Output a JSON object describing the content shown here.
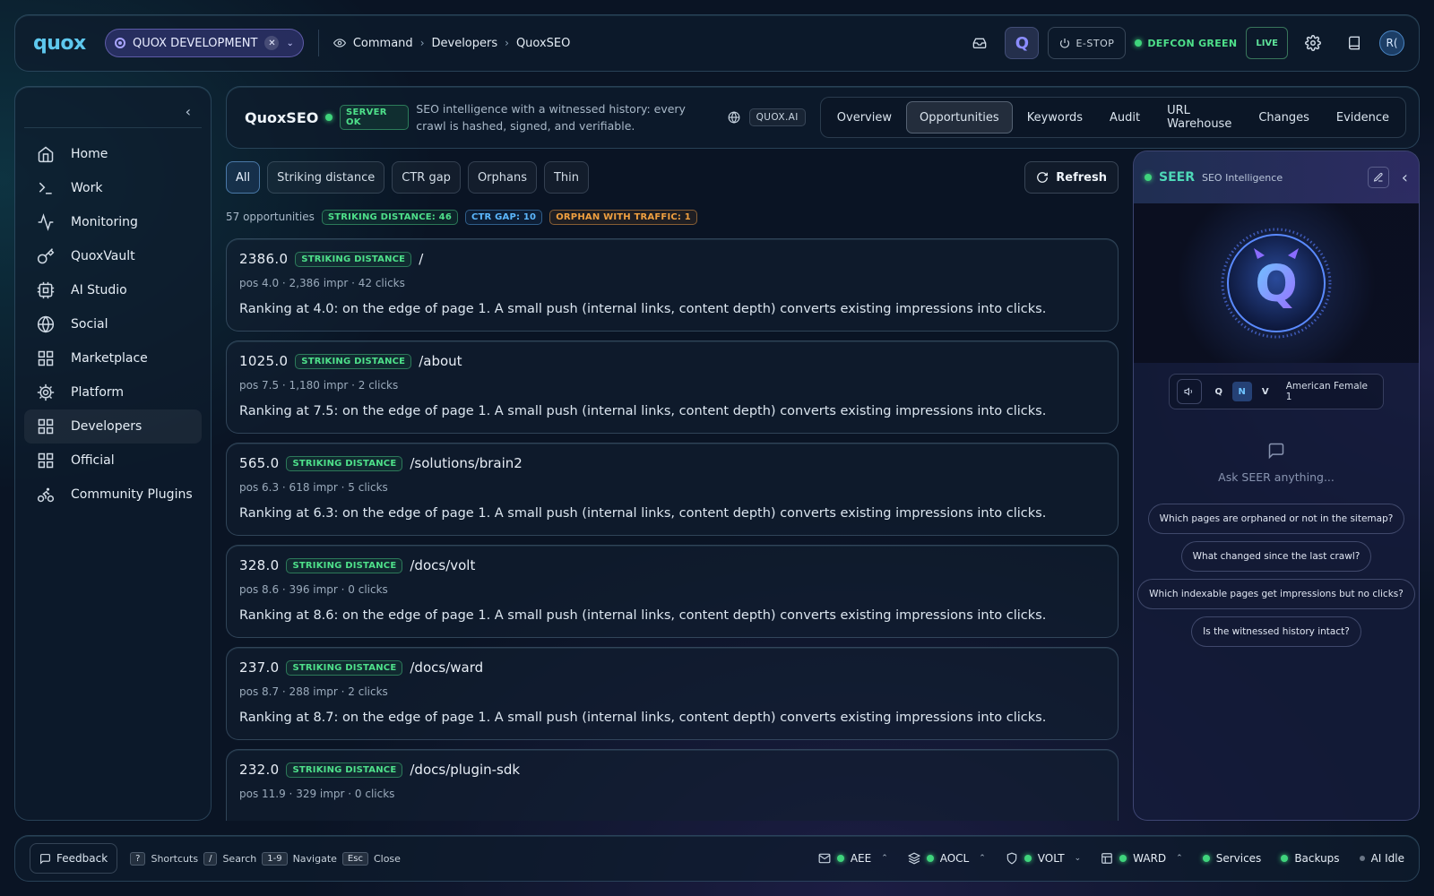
{
  "topbar": {
    "logo": "quox",
    "workspace": "QUOX DEVELOPMENT",
    "breadcrumbs": [
      "Command",
      "Developers",
      "QuoxSEO"
    ],
    "estop": "E-STOP",
    "defcon": "DEFCON GREEN",
    "live": "LIVE",
    "avatar_initials": "R("
  },
  "sidebar": {
    "items": [
      {
        "label": "Home",
        "icon": "home-icon"
      },
      {
        "label": "Work",
        "icon": "terminal-icon"
      },
      {
        "label": "Monitoring",
        "icon": "activity-icon"
      },
      {
        "label": "QuoxVault",
        "icon": "key-icon"
      },
      {
        "label": "AI Studio",
        "icon": "cpu-icon"
      },
      {
        "label": "Social",
        "icon": "globe-icon"
      },
      {
        "label": "Marketplace",
        "icon": "grid-icon"
      },
      {
        "label": "Platform",
        "icon": "gear-icon"
      },
      {
        "label": "Developers",
        "icon": "grid-icon"
      },
      {
        "label": "Official",
        "icon": "grid-icon"
      },
      {
        "label": "Community Plugins",
        "icon": "bike-icon"
      }
    ]
  },
  "app": {
    "name": "QuoxSEO",
    "status": "SERVER OK",
    "description": "SEO intelligence with a witnessed history: every crawl is hashed, signed, and verifiable.",
    "domain": "QUOX.AI",
    "tabs": [
      "Overview",
      "Opportunities",
      "Keywords",
      "Audit",
      "URL Warehouse",
      "Changes",
      "Evidence"
    ],
    "active_tab": "Opportunities"
  },
  "filters": {
    "chips": [
      "All",
      "Striking distance",
      "CTR gap",
      "Orphans",
      "Thin"
    ],
    "active": "All",
    "refresh_label": "Refresh"
  },
  "summary": {
    "count_text": "57 opportunities",
    "badges": [
      "STRIKING DISTANCE: 46",
      "CTR GAP: 10",
      "ORPHAN WITH TRAFFIC: 1"
    ]
  },
  "opportunities": [
    {
      "score": "2386.0",
      "badge": "STRIKING DISTANCE",
      "path": "/",
      "meta": "pos 4.0 · 2,386 impr · 42 clicks",
      "reason": "Ranking at 4.0: on the edge of page 1. A small push (internal links, content depth) converts existing impressions into clicks."
    },
    {
      "score": "1025.0",
      "badge": "STRIKING DISTANCE",
      "path": "/about",
      "meta": "pos 7.5 · 1,180 impr · 2 clicks",
      "reason": "Ranking at 7.5: on the edge of page 1. A small push (internal links, content depth) converts existing impressions into clicks."
    },
    {
      "score": "565.0",
      "badge": "STRIKING DISTANCE",
      "path": "/solutions/brain2",
      "meta": "pos 6.3 · 618 impr · 5 clicks",
      "reason": "Ranking at 6.3: on the edge of page 1. A small push (internal links, content depth) converts existing impressions into clicks."
    },
    {
      "score": "328.0",
      "badge": "STRIKING DISTANCE",
      "path": "/docs/volt",
      "meta": "pos 8.6 · 396 impr · 0 clicks",
      "reason": "Ranking at 8.6: on the edge of page 1. A small push (internal links, content depth) converts existing impressions into clicks."
    },
    {
      "score": "237.0",
      "badge": "STRIKING DISTANCE",
      "path": "/docs/ward",
      "meta": "pos 8.7 · 288 impr · 2 clicks",
      "reason": "Ranking at 8.7: on the edge of page 1. A small push (internal links, content depth) converts existing impressions into clicks."
    },
    {
      "score": "232.0",
      "badge": "STRIKING DISTANCE",
      "path": "/docs/plugin-sdk",
      "meta": "pos 11.9 · 329 impr · 0 clicks",
      "reason": ""
    }
  ],
  "seer": {
    "title": "SEER",
    "subtitle": "SEO Intelligence",
    "avatar_letter": "Q",
    "voice_modes": [
      "Q",
      "N",
      "V"
    ],
    "voice_active": "N",
    "voice_name": "American Female 1",
    "ask_placeholder": "Ask SEER anything...",
    "suggestions": [
      "Which pages are orphaned or not in the sitemap?",
      "What changed since the last crawl?",
      "Which indexable pages get impressions but no clicks?",
      "Is the witnessed history intact?"
    ]
  },
  "footer": {
    "feedback": "Feedback",
    "shortcuts": [
      {
        "key": "?",
        "label": "Shortcuts"
      },
      {
        "key": "/",
        "label": "Search"
      },
      {
        "key": "1-9",
        "label": "Navigate"
      },
      {
        "key": "Esc",
        "label": "Close"
      }
    ],
    "services": [
      {
        "label": "AEE",
        "icon": "mail-icon",
        "chevron": "up"
      },
      {
        "label": "AOCL",
        "icon": "layers-icon",
        "chevron": "up"
      },
      {
        "label": "VOLT",
        "icon": "shield-icon",
        "chevron": "down"
      },
      {
        "label": "WARD",
        "icon": "window-icon",
        "chevron": "up"
      },
      {
        "label": "Services"
      },
      {
        "label": "Backups"
      },
      {
        "label": "AI Idle"
      }
    ]
  },
  "colors": {
    "accent_green": "#3fd47c",
    "accent_blue": "#5cb8ff",
    "accent_orange": "#f0a040",
    "seer_teal": "#4ed8b8"
  }
}
